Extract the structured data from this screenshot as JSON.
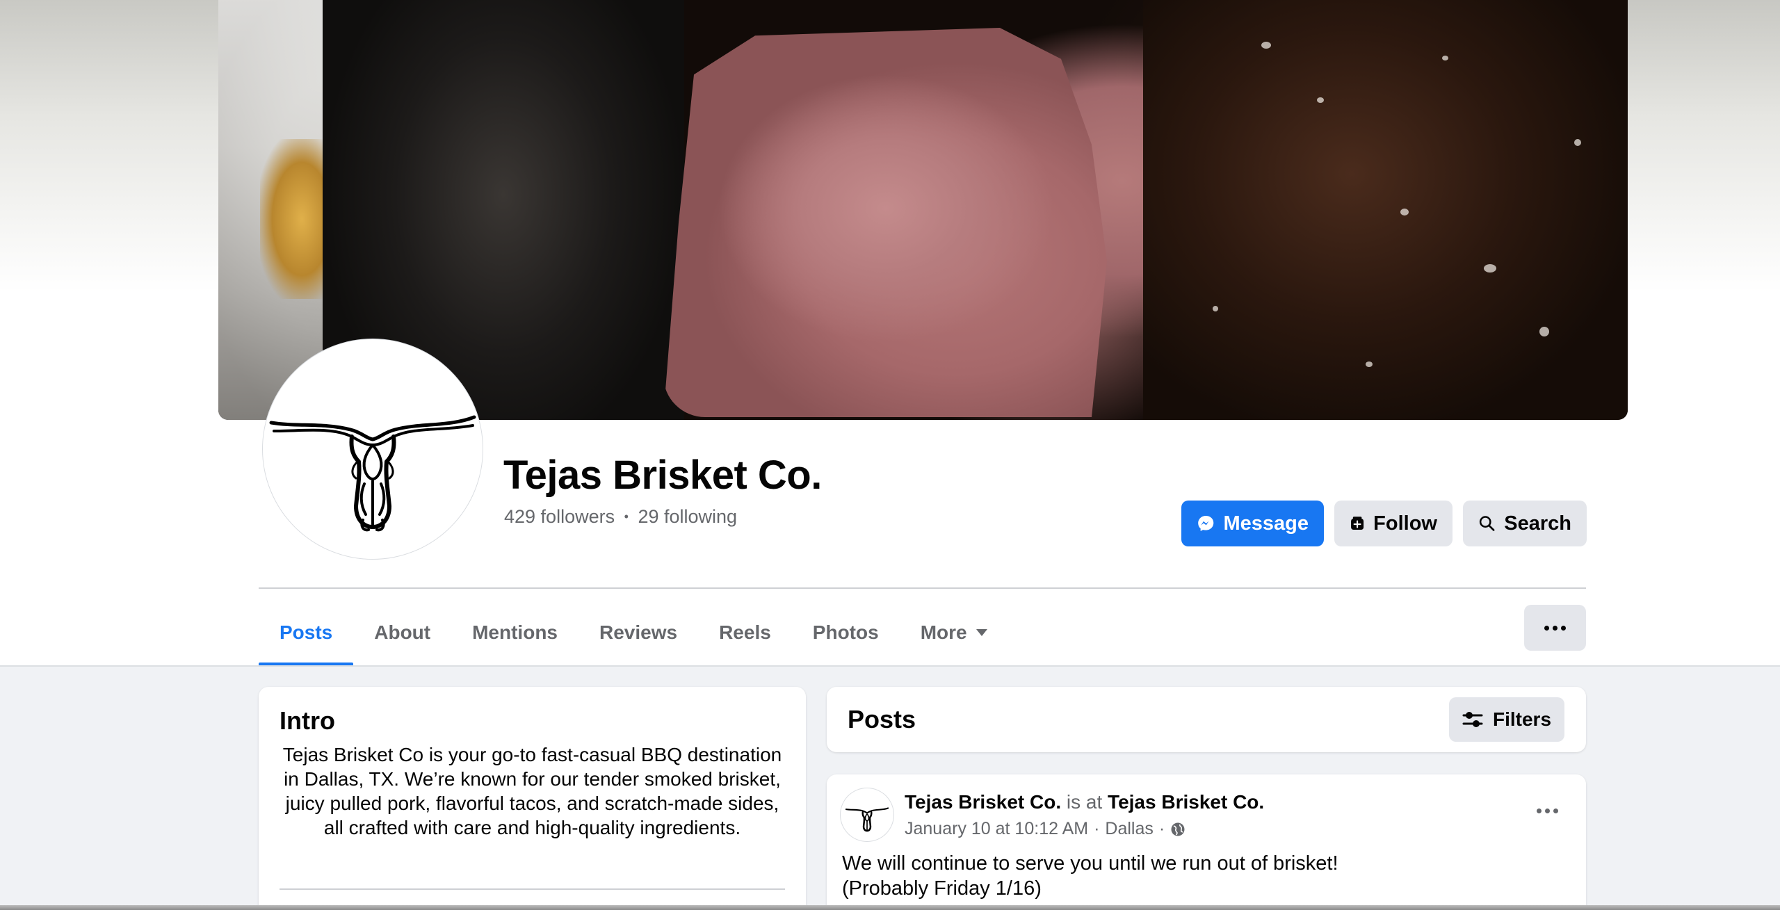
{
  "page": {
    "name": "Tejas Brisket Co.",
    "followers": "429 followers",
    "separator": "•",
    "following": "29 following"
  },
  "actions": {
    "message_label": "Message",
    "follow_label": "Follow",
    "search_label": "Search"
  },
  "tabs": [
    {
      "label": "Posts",
      "active": true
    },
    {
      "label": "About"
    },
    {
      "label": "Mentions"
    },
    {
      "label": "Reviews"
    },
    {
      "label": "Reels"
    },
    {
      "label": "Photos"
    },
    {
      "label": "More"
    }
  ],
  "intro": {
    "title": "Intro",
    "text": "Tejas Brisket Co is your go-to fast-casual BBQ destination in Dallas, TX. We’re known for our tender smoked brisket, juicy pulled pork, flavorful tacos, and scratch-made sides, all crafted with care and high-quality ingredients."
  },
  "posts_header": {
    "title": "Posts",
    "filters_label": "Filters"
  },
  "post": {
    "author": "Tejas Brisket Co.",
    "is_at": "is at",
    "location_page": "Tejas Brisket Co.",
    "timestamp": "January 10 at 10:12 AM",
    "meta_sep": "·",
    "place": "Dallas",
    "line1": "We will continue to serve you until we run out of brisket!",
    "line2": "(Probably Friday 1/16)"
  },
  "colors": {
    "accent": "#1877f2",
    "secondary_button": "#e4e6eb",
    "muted_text": "#65676b",
    "page_bg": "#f0f2f5"
  },
  "icons": {
    "message": "messenger-icon",
    "follow": "follow-plus-icon",
    "search": "search-icon",
    "filters": "sliders-icon",
    "more": "ellipsis-icon",
    "dropdown": "caret-down-icon",
    "privacy": "globe-icon"
  }
}
